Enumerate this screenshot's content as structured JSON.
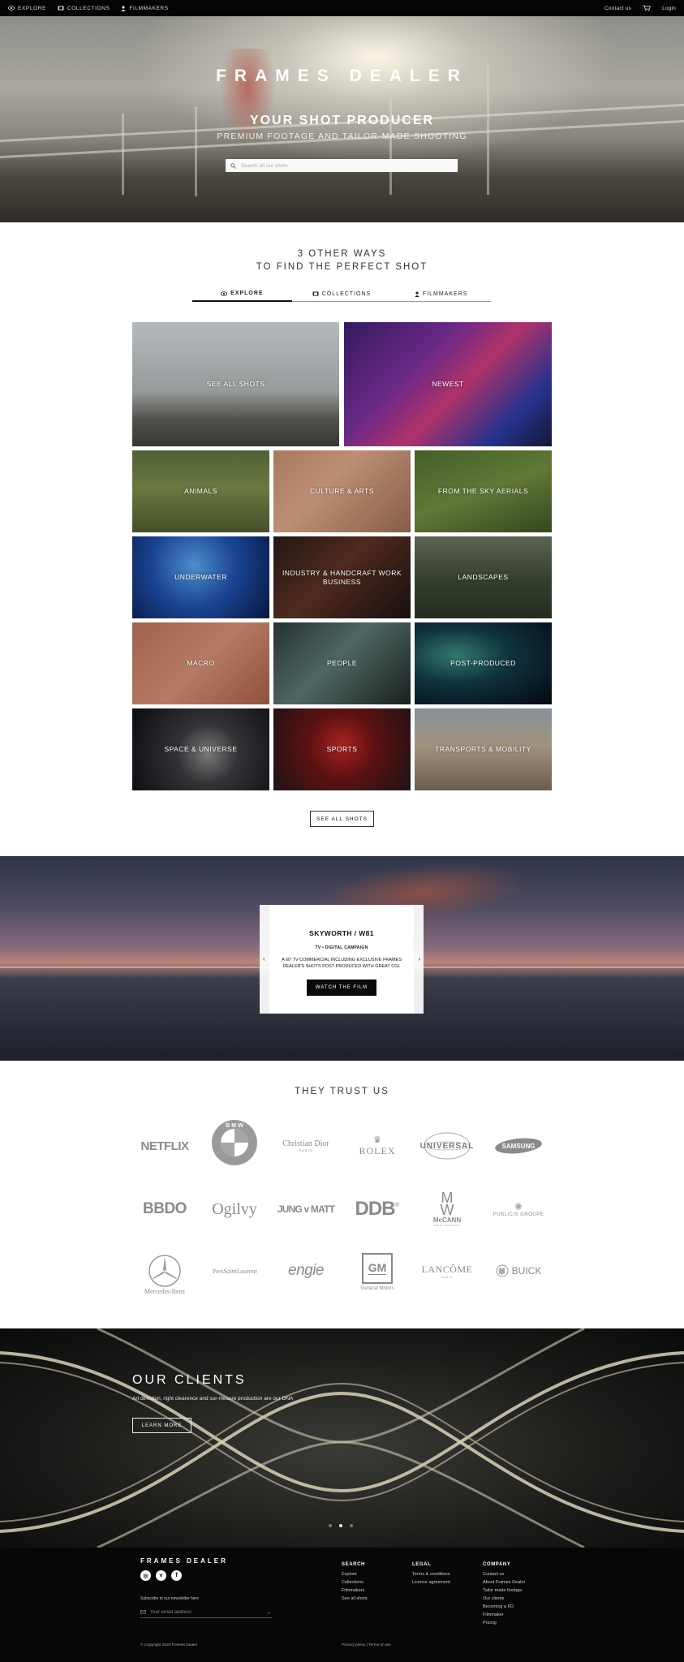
{
  "topnav": {
    "explore": "Explore",
    "collections": "Collections",
    "filmmakers": "Filmmakers",
    "contact": "Contact us",
    "login": "Login"
  },
  "hero": {
    "brand": "FRAMES DEALER",
    "tagline": "YOUR SHOT PRODUCER",
    "subtagline": "PREMIUM FOOTAGE AND TAILOR-MADE SHOOTING",
    "search_placeholder": "Search all our shots"
  },
  "ways": {
    "title_line1": "3 OTHER WAYS",
    "title_line2": "TO FIND THE PERFECT SHOT",
    "tabs": [
      {
        "label": "EXPLORE",
        "icon": "eye-icon",
        "active": true
      },
      {
        "label": "COLLECTIONS",
        "icon": "film-icon",
        "active": false
      },
      {
        "label": "FILMMAKERS",
        "icon": "person-icon",
        "active": false
      }
    ]
  },
  "categories": {
    "see_all": "SEE ALL SHOTS",
    "newest": "NEWEST",
    "animals": "ANIMALS",
    "culture": "CULTURE & ARTS",
    "aerials": "FROM THE SKY AERIALS",
    "underwater": "UNDERWATER",
    "industry": "INDUSTRY & HANDCRAFT WORK BUSINESS",
    "landscapes": "LANDSCAPES",
    "macro": "MACRO",
    "people": "PEOPLE",
    "postproduced": "POST-PRODUCED",
    "space": "SPACE & UNIVERSE",
    "sports": "SPORTS",
    "transports": "TRANSPORTS & MOBILITY",
    "button": "SEE ALL SHOTS"
  },
  "film": {
    "title": "SKYWORTH / W81",
    "subtitle": "TV • DIGITAL CAMPAIGN",
    "description": "A 60' TV COMMERCIAL INCLUDING EXCLUSIVE FRAMES DEALER'S SHOTS POST-PRODUCED WITH GREAT CGI.",
    "button": "WATCH THE FILM",
    "prev": "‹",
    "next": "›"
  },
  "trust": {
    "title": "THEY TRUST US",
    "logos": {
      "netflix": "NETFLIX",
      "bmw": "BMW",
      "dior": "Christian Dior",
      "dior_sub": "PARIS",
      "rolex": "ROLEX",
      "universal": "UNIVERSAL",
      "samsung": "SAMSUNG",
      "bbdo": "BBDO",
      "ogilvy": "Ogilvy",
      "jungvonmatt": "JUNG v MATT",
      "ddb": "DDB",
      "mccann": "McCANN",
      "mccann_sub": "WORLDGROUP",
      "publicis": "PUBLICIS GROUPE",
      "mercedes": "Mercedes-Benz",
      "ysl": "YvesSaintLaurent",
      "engie": "engie",
      "gm": "GM",
      "gm_sub": "General Motors",
      "lancome": "LANCÔME",
      "lancome_sub": "PARIS",
      "buick": "BUICK"
    }
  },
  "clients": {
    "title": "OUR CLIENTS",
    "description": "Art direction, right clearence and sur-mesure production are our DNA",
    "button": "LEARN MORE",
    "active_slide": 2,
    "slides": 3
  },
  "footer": {
    "brand": "FRAMES DEALER",
    "social": [
      "instagram-icon",
      "vimeo-icon",
      "facebook-icon"
    ],
    "newsletter": "Subscribe to our newsletter here",
    "email_placeholder": "Your email address",
    "search": {
      "title": "SEARCH",
      "links": [
        "Explore",
        "Collections",
        "Filmmakers",
        "See all shots"
      ]
    },
    "legal": {
      "title": "LEGAL",
      "links": [
        "Terms & conditions",
        "Licence agreement"
      ]
    },
    "company": {
      "title": "COMPANY",
      "links": [
        "Contact us",
        "About Frames Dealer",
        "Tailor made footage",
        "Our clients",
        "Becoming a FD",
        "Filmmaker",
        "Pricing"
      ]
    },
    "copyright": "© Copyright 2020 Frames Dealer",
    "privacy": "Privacy policy",
    "separator": " | ",
    "terms": "Terms of use"
  }
}
